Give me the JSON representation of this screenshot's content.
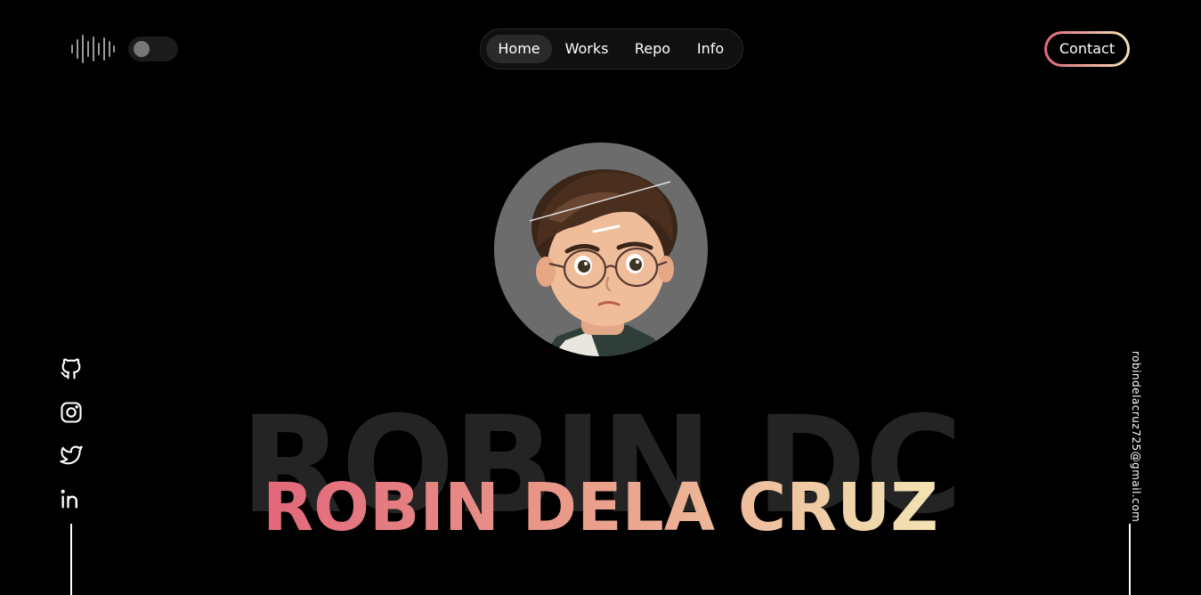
{
  "header": {
    "sound_icon": "sound-wave-icon",
    "theme_toggle_icon": "toggle-icon",
    "nav": [
      {
        "label": "Home",
        "active": true
      },
      {
        "label": "Works",
        "active": false
      },
      {
        "label": "Repo",
        "active": false
      },
      {
        "label": "Info",
        "active": false
      }
    ],
    "contact_label": "Contact"
  },
  "hero": {
    "avatar_icon": "avatar-image",
    "background_text": "ROBIN DC",
    "title": "ROBIN DELA CRUZ"
  },
  "socials": [
    {
      "name": "github",
      "icon": "github-icon"
    },
    {
      "name": "instagram",
      "icon": "instagram-icon"
    },
    {
      "name": "twitter",
      "icon": "twitter-icon"
    },
    {
      "name": "linkedin",
      "icon": "linkedin-icon"
    }
  ],
  "email": "robindelacruz725@gmail.com",
  "colors": {
    "background": "#000000",
    "gradient_start": "#e2677a",
    "gradient_end": "#f2e4b3",
    "avatar_bg": "#6c6c6c",
    "faded_text": "#242424"
  }
}
